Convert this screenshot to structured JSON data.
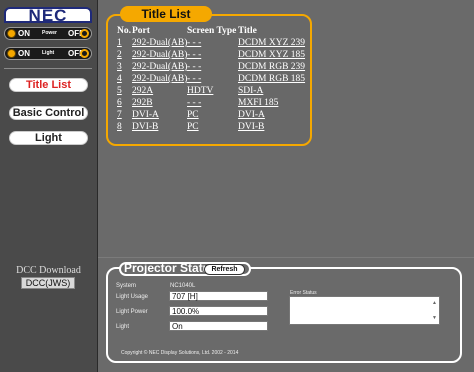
{
  "logo": "NEC",
  "power_toggle": {
    "on_label": "ON",
    "name": "Power",
    "off_label": "OFF"
  },
  "light_toggle": {
    "on_label": "ON",
    "name": "Light",
    "off_label": "OFF"
  },
  "nav": {
    "title_list": "Title List",
    "basic_control": "Basic Control",
    "light": "Light"
  },
  "dcc": {
    "title": "DCC Download",
    "button": "DCC(JWS)"
  },
  "title_list": {
    "heading": "Title List",
    "headers": {
      "no": "No.",
      "port": "Port",
      "screen_type": "Screen Type",
      "title": "Title"
    },
    "rows": [
      {
        "no": "1",
        "port": "292-Dual(AB)",
        "type": "- - -",
        "title": "DCDM XYZ 239"
      },
      {
        "no": "2",
        "port": "292-Dual(AB)",
        "type": "- - -",
        "title": "DCDM XYZ 185"
      },
      {
        "no": "3",
        "port": "292-Dual(AB)",
        "type": "- - -",
        "title": "DCDM RGB 239"
      },
      {
        "no": "4",
        "port": "292-Dual(AB)",
        "type": "- - -",
        "title": "DCDM RGB 185"
      },
      {
        "no": "5",
        "port": "292A",
        "type": "HDTV",
        "title": "SDI-A"
      },
      {
        "no": "6",
        "port": "292B",
        "type": "- - -",
        "title": "MXFI 185"
      },
      {
        "no": "7",
        "port": "DVI-A",
        "type": "PC",
        "title": "DVI-A"
      },
      {
        "no": "8",
        "port": "DVI-B",
        "type": "PC",
        "title": "DVI-B"
      }
    ]
  },
  "status": {
    "heading": "Projector Status",
    "refresh": "Refresh",
    "system_label": "System",
    "system_value": "NC1040L",
    "light_usage_label": "Light Usage",
    "light_usage_value": "707 [H]",
    "light_power_label": "Light Power",
    "light_power_value": "100.0%",
    "light_label": "Light",
    "light_value": "On",
    "error_label": "Error Status",
    "error_value": ""
  },
  "copyright": "Copyright © NEC Display Solutions, Ltd. 2002 - 2014",
  "colors": {
    "accent": "#f5a800",
    "active_nav": "#dd2222",
    "logo": "#1f2a7a"
  }
}
